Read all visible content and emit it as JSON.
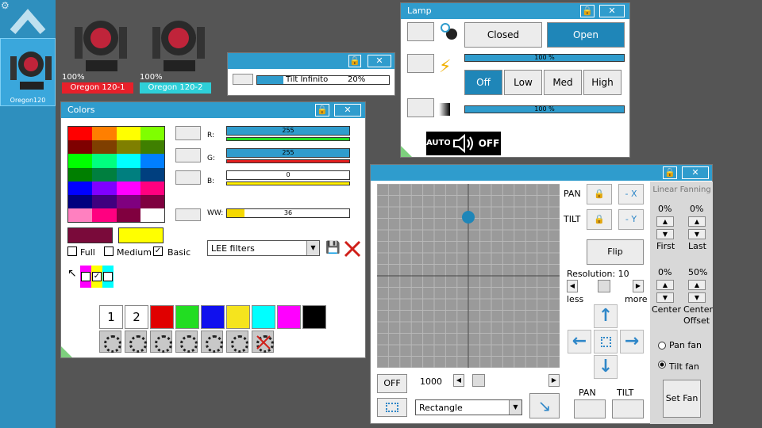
{
  "left_panel": {
    "fixture_label": "Oregon120"
  },
  "fixtures": [
    {
      "percent": "100%",
      "name": "Oregon 120-1",
      "color": "#e8202a"
    },
    {
      "percent": "100%",
      "name": "Oregon 120-2",
      "color": "#2ecfd8"
    }
  ],
  "tilt_win": {
    "label": "Tilt Infinito",
    "value": "20%",
    "level": 0.2
  },
  "lamp": {
    "title": "Lamp",
    "closed": "Closed",
    "open": "Open",
    "bar1": "100 %",
    "off": "Off",
    "low": "Low",
    "med": "Med",
    "high": "High",
    "bar2": "100 %",
    "auto": "AUTO",
    "off2": "OFF"
  },
  "colors": {
    "title": "Colors",
    "r_label": "R:",
    "r_value": "255",
    "g_label": "G:",
    "g_value": "255",
    "b_label": "B:",
    "b_value": "0",
    "ww_label": "WW:",
    "ww_value": "36",
    "full": "Full",
    "medium": "Medium",
    "basic": "Basic",
    "filter": "LEE filters",
    "num1": "1",
    "num2": "2",
    "swatches": [
      "#e00000",
      "#22dd22",
      "#1010ee",
      "#f5e41e",
      "#00ffff",
      "#ff00ff",
      "#000000"
    ],
    "palette": [
      "#ff0000",
      "#ff7f00",
      "#ffff00",
      "#7fff00",
      "#7f0000",
      "#7f3f00",
      "#7f7f00",
      "#3f7f00",
      "#00ff00",
      "#00ff7f",
      "#00ffff",
      "#007fff",
      "#007f00",
      "#007f3f",
      "#007f7f",
      "#003f7f",
      "#0000ff",
      "#7f00ff",
      "#ff00ff",
      "#ff007f",
      "#00007f",
      "#3f007f",
      "#7f007f",
      "#7f003f",
      "#ff80c0",
      "#ff0080",
      "#80003f",
      "#ffffff"
    ],
    "preview_a": "#7a0a3a",
    "preview_b": "#ffff00"
  },
  "pantilt": {
    "pan": "PAN",
    "tilt": "TILT",
    "minus_x": "- X",
    "minus_y": "- Y",
    "flip": "Flip",
    "resolution": "Resolution: 10",
    "less": "less",
    "more": "more",
    "off": "OFF",
    "speed": "1000",
    "shape": "Rectangle",
    "pan_btn": "PAN",
    "tilt_btn": "TILT",
    "fanning_title": "Linear Fanning",
    "first_pct": "0%",
    "last_pct": "0%",
    "first": "First",
    "last": "Last",
    "center_pct": "0%",
    "offset_pct": "50%",
    "center": "Center",
    "center_offset": "Center Offset",
    "pan_fan": "Pan fan",
    "tilt_fan": "Tilt fan",
    "set_fan": "Set Fan"
  }
}
